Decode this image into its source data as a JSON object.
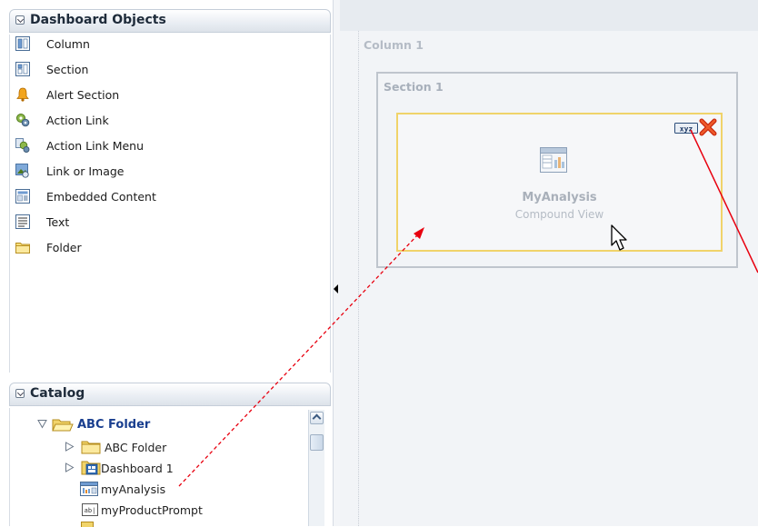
{
  "dashboard_objects": {
    "title": "Dashboard Objects",
    "items": [
      {
        "label": "Column",
        "icon": "column-icon"
      },
      {
        "label": "Section",
        "icon": "section-icon"
      },
      {
        "label": "Alert Section",
        "icon": "alert-bell-icon"
      },
      {
        "label": "Action Link",
        "icon": "action-link-icon"
      },
      {
        "label": "Action Link Menu",
        "icon": "action-link-menu-icon"
      },
      {
        "label": "Link or Image",
        "icon": "link-image-icon"
      },
      {
        "label": "Embedded Content",
        "icon": "embedded-content-icon"
      },
      {
        "label": "Text",
        "icon": "text-icon"
      },
      {
        "label": "Folder",
        "icon": "folder-icon"
      }
    ]
  },
  "catalog": {
    "title": "Catalog",
    "root": {
      "label": "ABC Folder",
      "icon": "open-folder-icon"
    },
    "children": [
      {
        "label": "ABC Folder",
        "icon": "folder-icon"
      },
      {
        "label": "Dashboard 1",
        "icon": "dashboard-icon"
      },
      {
        "label": "myAnalysis",
        "icon": "analysis-icon"
      },
      {
        "label": "myProductPrompt",
        "icon": "prompt-icon"
      }
    ]
  },
  "canvas": {
    "column_label": "Column 1",
    "section_label": "Section 1",
    "analysis": {
      "title": "MyAnalysis",
      "subtitle": "Compound View",
      "props_icon_text": "xyz"
    }
  },
  "colors": {
    "arrow": "#e8000f",
    "highlight_border": "#f0d36a",
    "selected_text": "#1a3f8f"
  }
}
